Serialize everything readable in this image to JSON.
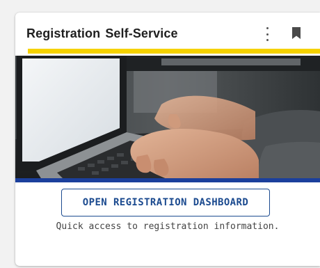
{
  "card": {
    "title": "Registration Self-Service",
    "menu_icon": "more-vert-icon",
    "bookmark_icon": "bookmark-icon",
    "accent_color": "#f5d200",
    "hero_image": "laptop-typing-photo",
    "hero_bar_color": "#1b3f9c",
    "button_label": "OPEN REGISTRATION DASHBOARD",
    "button_color": "#1b4a8f",
    "description": "Quick access to registration information."
  }
}
